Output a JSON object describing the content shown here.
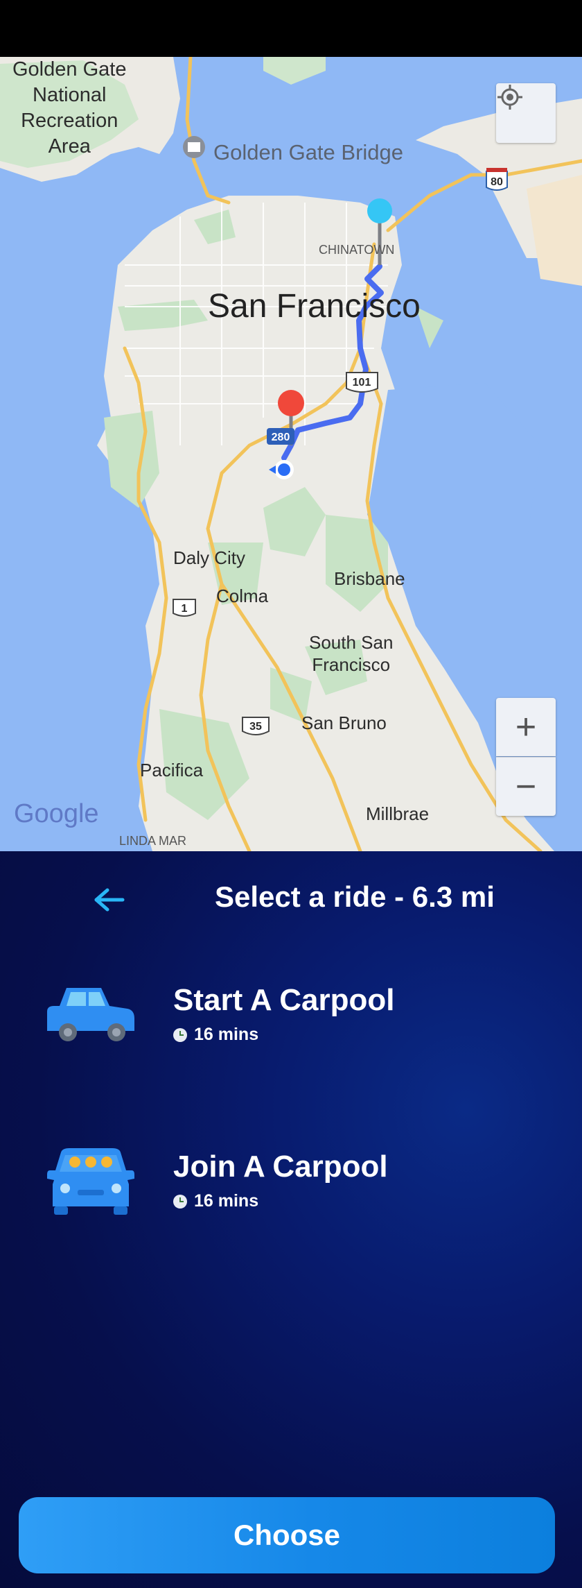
{
  "map": {
    "labels": {
      "golden_gate_area": "Golden Gate\nNational\nRecreation\nArea",
      "golden_gate_bridge": "Golden Gate Bridge",
      "chinatown": "CHINATOWN",
      "san_francisco": "San Francisco",
      "daly_city": "Daly City",
      "colma": "Colma",
      "brisbane": "Brisbane",
      "south_san_francisco": "South San\nFrancisco",
      "san_bruno": "San Bruno",
      "pacifica": "Pacifica",
      "millbrae": "Millbrae",
      "linda_mar": "LINDA MAR",
      "google": "Google"
    },
    "shields": {
      "us80": "80",
      "us101": "101",
      "i280": "280",
      "ca1": "1",
      "ca35": "35"
    },
    "controls": {
      "zoom_in": "+",
      "zoom_out": "−"
    }
  },
  "panel": {
    "title": "Select a ride - 6.3 mi",
    "rides": [
      {
        "title": "Start A Carpool",
        "time": "16 mins",
        "icon": "car-side-icon"
      },
      {
        "title": "Join A Carpool",
        "time": "16 mins",
        "icon": "car-front-icon"
      }
    ],
    "choose_label": "Choose"
  },
  "colors": {
    "accent": "#2f9ef6",
    "panel_bg": "#060f4c",
    "route": "#4a6cf0"
  }
}
